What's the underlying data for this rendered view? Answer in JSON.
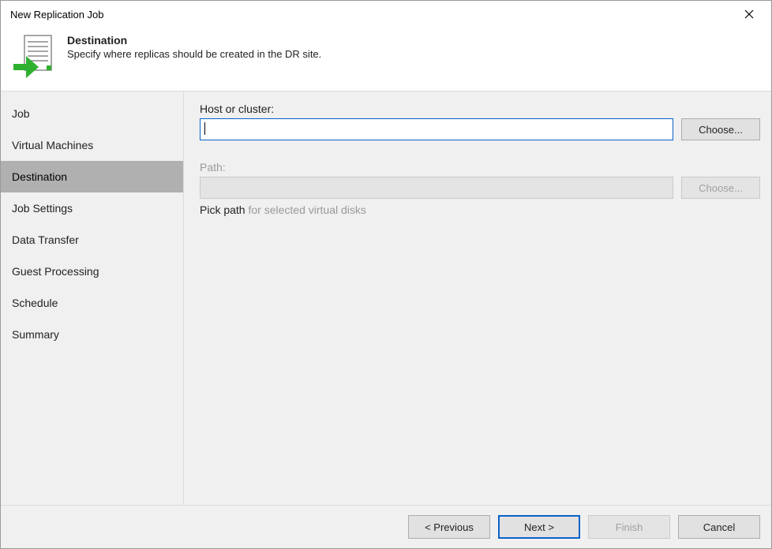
{
  "window": {
    "title": "New Replication Job"
  },
  "header": {
    "title": "Destination",
    "subtitle": "Specify where replicas should be created in the DR site."
  },
  "sidebar": {
    "items": [
      {
        "label": "Job",
        "active": false
      },
      {
        "label": "Virtual Machines",
        "active": false
      },
      {
        "label": "Destination",
        "active": true
      },
      {
        "label": "Job Settings",
        "active": false
      },
      {
        "label": "Data Transfer",
        "active": false
      },
      {
        "label": "Guest Processing",
        "active": false
      },
      {
        "label": "Schedule",
        "active": false
      },
      {
        "label": "Summary",
        "active": false
      }
    ]
  },
  "content": {
    "host": {
      "label": "Host or cluster:",
      "value": "",
      "choose": "Choose..."
    },
    "path": {
      "label": "Path:",
      "value": "",
      "choose": "Choose...",
      "pick_label": "Pick path",
      "pick_hint": "  for selected virtual disks"
    }
  },
  "footer": {
    "previous": "< Previous",
    "next": "Next >",
    "finish": "Finish",
    "cancel": "Cancel"
  }
}
